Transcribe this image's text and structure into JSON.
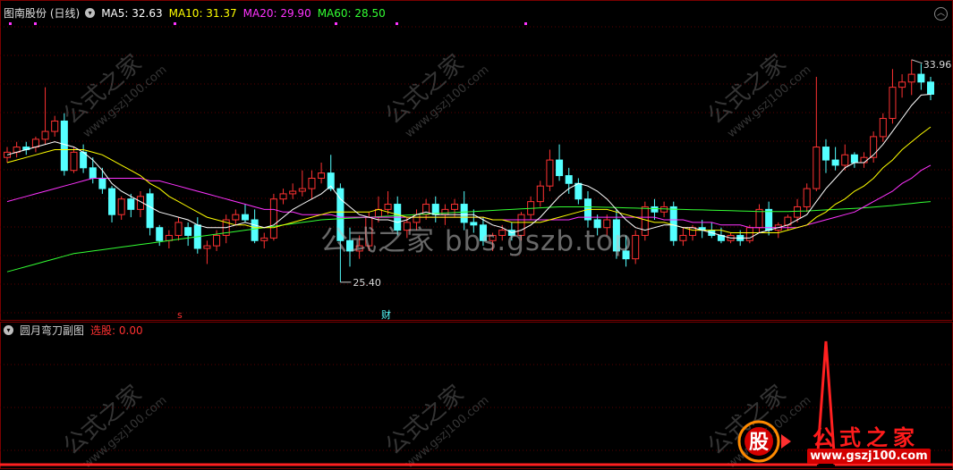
{
  "main_panel": {
    "title": "图南股份 (日线)",
    "ma_items": [
      {
        "label": "MA5: 32.63",
        "color": "#ffffff"
      },
      {
        "label": "MA10: 31.37",
        "color": "#ffff00"
      },
      {
        "label": "MA20: 29.90",
        "color": "#ff33ff"
      },
      {
        "label": "MA60: 28.50",
        "color": "#33ff33"
      }
    ],
    "high_label": "33.96",
    "low_label": "25.40",
    "marker_s": "s",
    "marker_cai": "财"
  },
  "sub_panel": {
    "title": "圆月弯刀副图",
    "value_label": "选股: 0.00"
  },
  "watermark": {
    "text": "公式之家 bbs.gszb.top",
    "diag": "公式之家",
    "diag_url": "www.gszj100.com",
    "brand_title": "公式之家",
    "brand_url": "www.gszj100.com",
    "brand_logo": "股"
  },
  "colors": {
    "up": "#ff3232",
    "down": "#54ffff",
    "ma5": "#ffffff",
    "ma10": "#ffff00",
    "ma20": "#ff33ff",
    "ma60": "#33ff33",
    "signal": "#ff2020"
  },
  "chart_data": {
    "type": "candlestick",
    "price_range": [
      24.5,
      35.5
    ],
    "candles": [
      [
        30.2,
        30.6,
        30.0,
        30.4
      ],
      [
        30.4,
        30.8,
        30.2,
        30.6
      ],
      [
        30.6,
        30.8,
        30.3,
        30.5
      ],
      [
        30.6,
        31.0,
        30.4,
        30.9
      ],
      [
        30.9,
        32.9,
        30.7,
        31.2
      ],
      [
        31.2,
        31.8,
        31.0,
        31.6
      ],
      [
        31.6,
        31.9,
        29.5,
        29.7
      ],
      [
        29.7,
        30.6,
        29.6,
        30.4
      ],
      [
        30.4,
        30.7,
        29.6,
        29.8
      ],
      [
        29.8,
        30.2,
        29.2,
        29.4
      ],
      [
        29.4,
        29.8,
        28.8,
        29.0
      ],
      [
        29.0,
        29.1,
        27.7,
        28.0
      ],
      [
        28.0,
        28.7,
        27.8,
        28.6
      ],
      [
        28.6,
        28.8,
        27.9,
        28.2
      ],
      [
        28.2,
        28.9,
        27.9,
        28.7
      ],
      [
        28.8,
        29.0,
        27.2,
        27.5
      ],
      [
        27.5,
        27.6,
        26.8,
        27.0
      ],
      [
        27.0,
        27.4,
        26.7,
        27.2
      ],
      [
        27.2,
        27.9,
        27.0,
        27.7
      ],
      [
        27.5,
        27.7,
        26.8,
        27.2
      ],
      [
        27.6,
        27.9,
        26.5,
        26.7
      ],
      [
        26.7,
        27.0,
        26.1,
        26.8
      ],
      [
        26.8,
        27.4,
        26.6,
        27.2
      ],
      [
        27.2,
        28.0,
        26.9,
        27.8
      ],
      [
        27.8,
        28.2,
        27.6,
        28.0
      ],
      [
        28.0,
        28.4,
        27.7,
        27.8
      ],
      [
        27.8,
        28.2,
        26.9,
        27.0
      ],
      [
        27.0,
        27.3,
        26.7,
        27.1
      ],
      [
        27.1,
        28.8,
        27.0,
        28.6
      ],
      [
        28.6,
        29.0,
        28.4,
        28.8
      ],
      [
        28.8,
        29.2,
        28.6,
        28.9
      ],
      [
        28.9,
        29.7,
        28.7,
        29.0
      ],
      [
        29.0,
        29.7,
        28.6,
        29.4
      ],
      [
        29.4,
        30.0,
        29.2,
        29.6
      ],
      [
        29.6,
        30.3,
        28.9,
        29.0
      ],
      [
        29.0,
        29.2,
        25.4,
        27.0
      ],
      [
        27.0,
        27.5,
        26.0,
        26.6
      ],
      [
        26.6,
        27.2,
        26.3,
        26.8
      ],
      [
        26.8,
        28.1,
        26.6,
        27.9
      ],
      [
        27.9,
        28.7,
        27.7,
        28.2
      ],
      [
        28.2,
        28.9,
        28.0,
        28.4
      ],
      [
        28.4,
        28.7,
        27.2,
        27.4
      ],
      [
        27.4,
        27.9,
        27.1,
        27.7
      ],
      [
        27.7,
        28.2,
        27.4,
        28.0
      ],
      [
        28.0,
        28.6,
        27.8,
        28.4
      ],
      [
        28.4,
        28.7,
        27.7,
        28.0
      ],
      [
        28.0,
        28.4,
        27.6,
        28.2
      ],
      [
        28.2,
        28.6,
        27.9,
        28.4
      ],
      [
        28.4,
        28.9,
        27.4,
        27.7
      ],
      [
        27.7,
        28.2,
        27.3,
        27.6
      ],
      [
        27.6,
        27.9,
        26.8,
        27.0
      ],
      [
        27.0,
        27.3,
        26.6,
        27.2
      ],
      [
        27.2,
        27.6,
        27.0,
        27.4
      ],
      [
        27.4,
        27.7,
        27.0,
        27.2
      ],
      [
        27.2,
        28.1,
        27.0,
        28.0
      ],
      [
        28.0,
        28.7,
        27.8,
        28.5
      ],
      [
        28.5,
        29.3,
        28.3,
        29.1
      ],
      [
        29.1,
        30.5,
        28.9,
        30.1
      ],
      [
        30.1,
        30.7,
        29.3,
        29.5
      ],
      [
        29.5,
        29.8,
        28.8,
        29.2
      ],
      [
        29.2,
        29.4,
        28.4,
        28.6
      ],
      [
        28.6,
        28.9,
        27.5,
        27.8
      ],
      [
        27.8,
        28.0,
        27.2,
        27.5
      ],
      [
        27.5,
        28.0,
        27.2,
        27.8
      ],
      [
        27.8,
        28.2,
        26.3,
        26.6
      ],
      [
        26.6,
        27.2,
        26.0,
        26.3
      ],
      [
        26.3,
        27.4,
        26.1,
        27.2
      ],
      [
        27.2,
        28.5,
        27.0,
        28.3
      ],
      [
        28.3,
        28.6,
        27.8,
        28.1
      ],
      [
        28.1,
        28.5,
        27.9,
        28.3
      ],
      [
        28.3,
        28.5,
        26.8,
        27.0
      ],
      [
        27.0,
        27.5,
        26.8,
        27.2
      ],
      [
        27.2,
        27.6,
        27.0,
        27.5
      ],
      [
        27.5,
        27.8,
        27.1,
        27.4
      ],
      [
        27.4,
        27.7,
        27.1,
        27.2
      ],
      [
        27.2,
        27.5,
        26.9,
        27.0
      ],
      [
        27.0,
        27.3,
        26.9,
        27.2
      ],
      [
        27.2,
        27.4,
        26.8,
        27.0
      ],
      [
        27.0,
        27.6,
        26.9,
        27.5
      ],
      [
        27.5,
        28.4,
        27.3,
        28.2
      ],
      [
        28.2,
        28.5,
        27.2,
        27.4
      ],
      [
        27.4,
        27.7,
        27.1,
        27.6
      ],
      [
        27.6,
        28.0,
        27.4,
        27.9
      ],
      [
        27.9,
        28.6,
        27.7,
        28.3
      ],
      [
        28.3,
        29.2,
        28.1,
        29.0
      ],
      [
        29.0,
        33.3,
        28.9,
        30.6
      ],
      [
        30.6,
        30.9,
        29.6,
        30.1
      ],
      [
        30.1,
        30.6,
        29.7,
        29.9
      ],
      [
        29.9,
        30.7,
        29.7,
        30.3
      ],
      [
        30.3,
        30.4,
        29.8,
        30.0
      ],
      [
        30.0,
        30.4,
        29.8,
        30.2
      ],
      [
        30.2,
        31.2,
        30.0,
        31.0
      ],
      [
        31.0,
        31.9,
        30.8,
        31.7
      ],
      [
        31.7,
        33.6,
        31.5,
        32.9
      ],
      [
        32.9,
        33.4,
        32.5,
        33.1
      ],
      [
        33.1,
        33.96,
        32.6,
        33.4
      ],
      [
        33.4,
        33.8,
        32.8,
        33.1
      ],
      [
        33.1,
        33.3,
        32.4,
        32.63
      ]
    ],
    "ma5": [
      30.3,
      30.4,
      30.5,
      30.6,
      30.7,
      30.8,
      30.7,
      30.6,
      30.4,
      30.1,
      29.7,
      29.2,
      28.9,
      28.7,
      28.5,
      28.3,
      28.1,
      28.0,
      27.9,
      27.8,
      27.6,
      27.5,
      27.5,
      27.5,
      27.6,
      27.7,
      27.6,
      27.5,
      27.6,
      27.9,
      28.2,
      28.4,
      28.6,
      28.8,
      29.1,
      28.6,
      28.3,
      28.0,
      27.9,
      27.8,
      27.8,
      27.7,
      27.8,
      28.0,
      28.1,
      28.0,
      28.0,
      28.0,
      28.0,
      28.0,
      27.8,
      27.6,
      27.5,
      27.3,
      27.4,
      27.6,
      27.9,
      28.3,
      28.7,
      29.0,
      29.2,
      29.1,
      28.9,
      28.6,
      28.2,
      27.8,
      27.5,
      27.4,
      27.5,
      27.6,
      27.6,
      27.5,
      27.5,
      27.4,
      27.3,
      27.2,
      27.1,
      27.1,
      27.1,
      27.3,
      27.4,
      27.5,
      27.6,
      27.8,
      28.0,
      28.5,
      29.0,
      29.4,
      29.8,
      30.0,
      30.0,
      30.3,
      30.7,
      31.2,
      31.7,
      32.2,
      32.6,
      32.63
    ],
    "ma10": [
      30.0,
      30.1,
      30.2,
      30.3,
      30.4,
      30.5,
      30.5,
      30.5,
      30.5,
      30.4,
      30.3,
      30.1,
      29.9,
      29.7,
      29.5,
      29.2,
      29.0,
      28.7,
      28.5,
      28.3,
      28.1,
      27.9,
      27.8,
      27.7,
      27.6,
      27.6,
      27.5,
      27.5,
      27.5,
      27.6,
      27.7,
      27.8,
      27.9,
      28.0,
      28.1,
      28.1,
      28.1,
      28.1,
      28.1,
      28.2,
      28.1,
      28.0,
      27.9,
      27.9,
      27.9,
      27.9,
      27.9,
      27.9,
      27.9,
      27.9,
      27.9,
      27.8,
      27.8,
      27.7,
      27.7,
      27.7,
      27.7,
      27.8,
      27.9,
      28.0,
      28.1,
      28.2,
      28.2,
      28.2,
      28.1,
      28.0,
      27.9,
      27.8,
      27.7,
      27.7,
      27.6,
      27.5,
      27.4,
      27.4,
      27.4,
      27.4,
      27.3,
      27.3,
      27.3,
      27.3,
      27.3,
      27.3,
      27.4,
      27.5,
      27.6,
      27.9,
      28.1,
      28.4,
      28.6,
      28.9,
      29.1,
      29.4,
      29.8,
      30.1,
      30.5,
      30.8,
      31.1,
      31.37
    ],
    "ma20": [
      28.5,
      28.6,
      28.7,
      28.8,
      28.9,
      29.0,
      29.1,
      29.2,
      29.3,
      29.4,
      29.4,
      29.4,
      29.4,
      29.4,
      29.4,
      29.3,
      29.3,
      29.2,
      29.1,
      29.0,
      28.9,
      28.8,
      28.7,
      28.6,
      28.5,
      28.4,
      28.3,
      28.2,
      28.2,
      28.1,
      28.1,
      28.0,
      28.0,
      28.0,
      28.0,
      27.9,
      27.9,
      27.9,
      27.9,
      27.9,
      27.9,
      27.9,
      27.9,
      27.9,
      27.9,
      27.9,
      27.9,
      27.9,
      27.9,
      27.9,
      27.9,
      27.8,
      27.8,
      27.8,
      27.8,
      27.8,
      27.8,
      27.8,
      27.8,
      27.8,
      27.9,
      27.9,
      27.9,
      27.9,
      27.9,
      27.9,
      27.9,
      27.9,
      27.9,
      27.8,
      27.8,
      27.8,
      27.7,
      27.7,
      27.7,
      27.6,
      27.6,
      27.6,
      27.5,
      27.5,
      27.5,
      27.5,
      27.5,
      27.5,
      27.6,
      27.7,
      27.8,
      27.9,
      28.0,
      28.1,
      28.3,
      28.5,
      28.7,
      28.9,
      29.2,
      29.4,
      29.7,
      29.9
    ],
    "ma60": [
      25.8,
      25.9,
      26.0,
      26.1,
      26.2,
      26.3,
      26.4,
      26.5,
      26.55,
      26.6,
      26.65,
      26.7,
      26.75,
      26.8,
      26.85,
      26.9,
      26.95,
      27.0,
      27.05,
      27.1,
      27.15,
      27.2,
      27.25,
      27.3,
      27.35,
      27.4,
      27.45,
      27.5,
      27.55,
      27.6,
      27.65,
      27.7,
      27.75,
      27.8,
      27.82,
      27.84,
      27.86,
      27.88,
      27.9,
      27.92,
      27.94,
      27.96,
      27.98,
      28.0,
      28.02,
      28.04,
      28.06,
      28.08,
      28.1,
      28.12,
      28.14,
      28.16,
      28.18,
      28.2,
      28.22,
      28.24,
      28.26,
      28.28,
      28.3,
      28.3,
      28.3,
      28.3,
      28.29,
      28.28,
      28.27,
      28.26,
      28.25,
      28.24,
      28.23,
      28.22,
      28.21,
      28.2,
      28.19,
      28.18,
      28.17,
      28.16,
      28.15,
      28.14,
      28.13,
      28.12,
      28.12,
      28.12,
      28.12,
      28.13,
      28.14,
      28.16,
      28.18,
      28.2,
      28.22,
      28.24,
      28.26,
      28.29,
      28.32,
      28.35,
      28.39,
      28.43,
      28.47,
      28.5
    ],
    "signal": {
      "peak_index": 86,
      "range": [
        0,
        1
      ]
    }
  }
}
